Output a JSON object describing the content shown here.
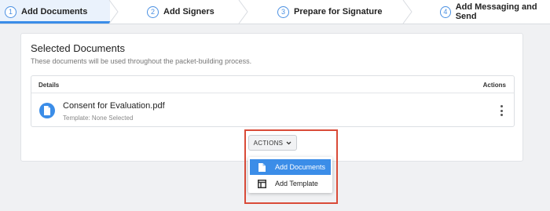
{
  "stepper": {
    "steps": [
      {
        "num": "1",
        "label": "Add Documents"
      },
      {
        "num": "2",
        "label": "Add Signers"
      },
      {
        "num": "3",
        "label": "Prepare for Signature"
      },
      {
        "num": "4",
        "label": "Add Messaging and Send"
      }
    ],
    "active_index": 0
  },
  "card": {
    "title": "Selected Documents",
    "subtitle": "These documents will be used throughout the packet-building process.",
    "table": {
      "col_details": "Details",
      "col_actions": "Actions",
      "rows": [
        {
          "name": "Consent for Evaluation.pdf",
          "template": "Template: None Selected"
        }
      ]
    }
  },
  "actions": {
    "button_label": "ACTIONS",
    "menu": [
      {
        "label": "Add Documents",
        "icon": "document-icon",
        "active": true
      },
      {
        "label": "Add Template",
        "icon": "template-icon",
        "active": false
      }
    ]
  },
  "colors": {
    "accent": "#3b8de8",
    "highlight": "#d94b38"
  }
}
